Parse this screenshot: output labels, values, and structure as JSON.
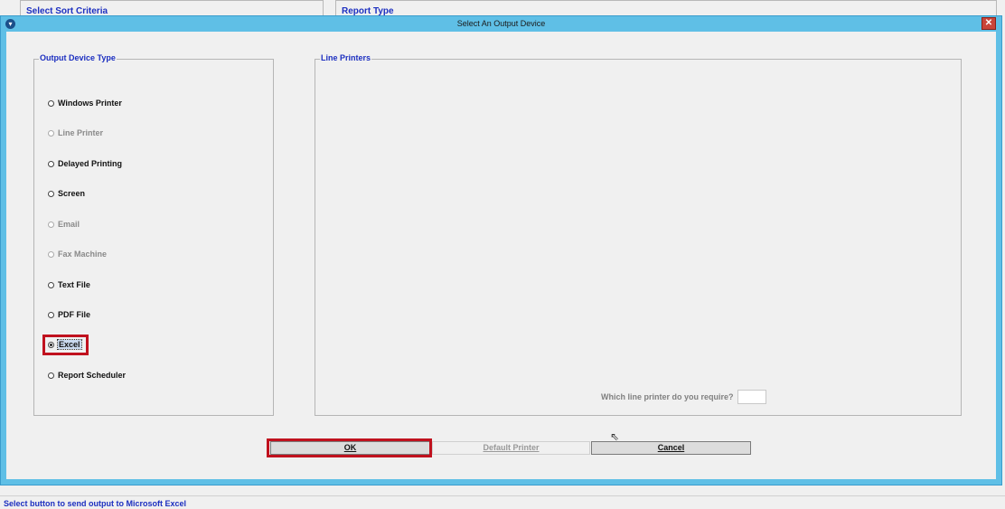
{
  "background_tabs": {
    "sort_criteria": "Select Sort Criteria",
    "report_type": "Report Type"
  },
  "dialog": {
    "title": "Select An Output Device",
    "close_glyph": "✕"
  },
  "output_device_type": {
    "title": "Output Device Type",
    "options": [
      {
        "label": "Windows Printer",
        "enabled": true,
        "checked": false
      },
      {
        "label": "Line Printer",
        "enabled": false,
        "checked": false
      },
      {
        "label": "Delayed Printing",
        "enabled": true,
        "checked": false
      },
      {
        "label": "Screen",
        "enabled": true,
        "checked": false
      },
      {
        "label": "Email",
        "enabled": false,
        "checked": false
      },
      {
        "label": "Fax Machine",
        "enabled": false,
        "checked": false
      },
      {
        "label": "Text File",
        "enabled": true,
        "checked": false
      },
      {
        "label": "PDF File",
        "enabled": true,
        "checked": false
      },
      {
        "label": "Excel",
        "enabled": true,
        "checked": true
      },
      {
        "label": "Report Scheduler",
        "enabled": true,
        "checked": false
      }
    ]
  },
  "line_printers": {
    "title": "Line Printers",
    "question": "Which line printer do you require?",
    "input_value": ""
  },
  "buttons": {
    "ok": "OK",
    "default_printer": "Default Printer",
    "cancel": "Cancel"
  },
  "status_bar": {
    "text": "Select button to send output to Microsoft Excel"
  },
  "colors": {
    "accent_title_bar": "#5fbfe6",
    "group_title_text": "#1c2fc0",
    "highlight_annotation": "#c0111e"
  }
}
